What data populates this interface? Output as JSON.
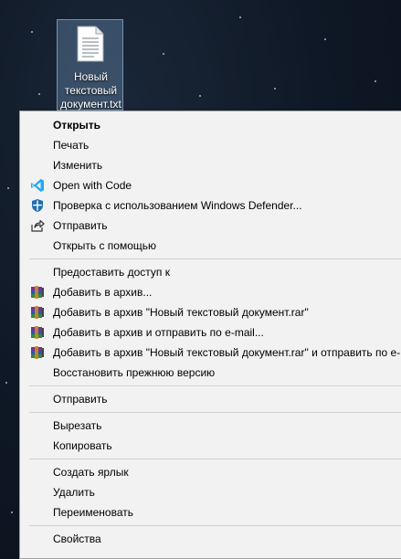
{
  "desktop": {
    "file_icon": {
      "icon": "text-file-icon",
      "label": "Новый текстовый документ.txt"
    }
  },
  "menu": {
    "groups": [
      [
        {
          "label": "Открыть",
          "bold": true,
          "icon": ""
        },
        {
          "label": "Печать",
          "icon": ""
        },
        {
          "label": "Изменить",
          "icon": ""
        },
        {
          "label": "Open with Code",
          "icon": "vscode-icon"
        },
        {
          "label": "Проверка с использованием Windows Defender...",
          "icon": "defender-shield-icon"
        },
        {
          "label": "Отправить",
          "icon": "share-icon"
        },
        {
          "label": "Открыть с помощью",
          "icon": ""
        }
      ],
      [
        {
          "label": "Предоставить доступ к",
          "icon": ""
        },
        {
          "label": "Добавить в архив...",
          "icon": "winrar-icon"
        },
        {
          "label": "Добавить в архив \"Новый текстовый документ.rar\"",
          "icon": "winrar-icon"
        },
        {
          "label": "Добавить в архив и отправить по e-mail...",
          "icon": "winrar-icon"
        },
        {
          "label": "Добавить в архив \"Новый текстовый документ.rar\" и отправить по e-mail",
          "icon": "winrar-icon"
        },
        {
          "label": "Восстановить прежнюю версию",
          "icon": ""
        }
      ],
      [
        {
          "label": "Отправить",
          "icon": ""
        }
      ],
      [
        {
          "label": "Вырезать",
          "icon": ""
        },
        {
          "label": "Копировать",
          "icon": ""
        }
      ],
      [
        {
          "label": "Создать ярлык",
          "icon": ""
        },
        {
          "label": "Удалить",
          "icon": ""
        },
        {
          "label": "Переименовать",
          "icon": ""
        }
      ],
      [
        {
          "label": "Свойства",
          "icon": ""
        }
      ]
    ]
  },
  "colors": {
    "menu_bg": "#f2f2f2",
    "separator": "#d0d0d0",
    "vscode_blue": "#23a9f2",
    "defender_blue": "#1f6fb2"
  }
}
